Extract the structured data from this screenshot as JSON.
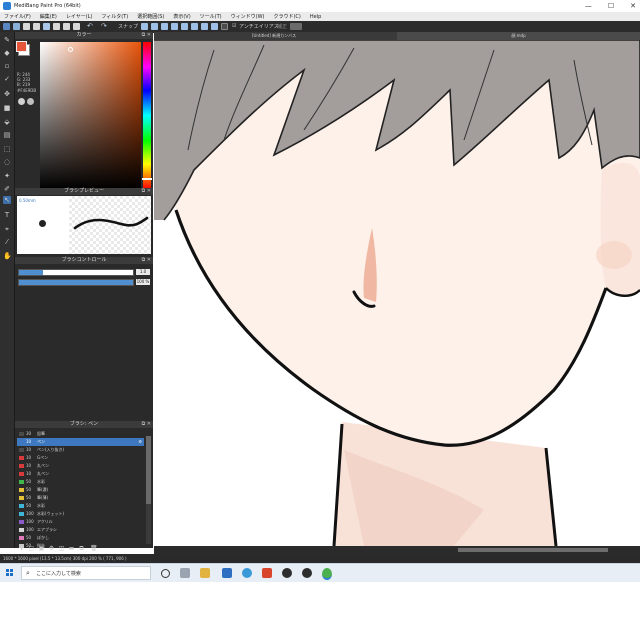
{
  "window": {
    "title": "MediBang Paint Pro (64bit)",
    "controls": [
      "—",
      "☐",
      "✕"
    ]
  },
  "menu": [
    "ファイル(F)",
    "編集(E)",
    "レイヤー(L)",
    "フィルタ(T)",
    "選択範囲(S)",
    "表示(V)",
    "ツール(T)",
    "ウィンドウ(W)",
    "クラウド(C)",
    "Help"
  ],
  "toolbar": {
    "snap_label": "スナップ",
    "antialias_label": "アンチエイリアス",
    "correction_label": "補正"
  },
  "canvas_tabs": [
    "[Untitled] 新規カンバス",
    "顔.mdp"
  ],
  "color_panel": {
    "title": "カラー",
    "fg_color": "#e4553a",
    "readouts": [
      "R: 244",
      "G: 233",
      "B: 219",
      "#F4E9DB"
    ]
  },
  "brush_preview": {
    "title": "ブラシプレビュー",
    "size_label": "0.50mm"
  },
  "brush_control": {
    "title": "ブラシコントロール",
    "size_value": "1.0",
    "opacity_value": "100 %",
    "size_fill": 0.21,
    "opacity_fill": 1.0
  },
  "brush_list": {
    "title": "ブラシ: ペン",
    "items": [
      {
        "size": "30",
        "name": "鉛筆",
        "color": "#4a4a4a"
      },
      {
        "size": "10",
        "name": "ペン",
        "color": "#3d78c0",
        "selected": true
      },
      {
        "size": "10",
        "name": "ペン(入り抜き)",
        "color": "#4a4a4a"
      },
      {
        "size": "10",
        "name": "Gペン",
        "color": "#d63a3a"
      },
      {
        "size": "10",
        "name": "丸ペン",
        "color": "#d63a3a"
      },
      {
        "size": "10",
        "name": "丸ペン",
        "color": "#d63a3a"
      },
      {
        "size": "50",
        "name": "水彩",
        "color": "#3fb64a"
      },
      {
        "size": "50",
        "name": "筆(濃)",
        "color": "#e3c23a"
      },
      {
        "size": "50",
        "name": "筆(薄)",
        "color": "#e3c23a"
      },
      {
        "size": "50",
        "name": "水彩",
        "color": "#3fb6d6"
      },
      {
        "size": "100",
        "name": "水彩(ウェット)",
        "color": "#3fb6d6"
      },
      {
        "size": "100",
        "name": "アクリル",
        "color": "#8a5ac8"
      },
      {
        "size": "100",
        "name": "エアブラシ",
        "color": "#d6d6d6"
      },
      {
        "size": "50",
        "name": "ぼかし",
        "color": "#e07ab8"
      },
      {
        "size": "50",
        "name": "指先",
        "color": "#c8c8c8"
      }
    ]
  },
  "status": {
    "text": "1600 * 1600 pixel (13.5 * 13.5cm) 300 dpi 200 % ( 771, 906 )"
  },
  "taskbar": {
    "search_placeholder": "ここに入力して検索"
  }
}
